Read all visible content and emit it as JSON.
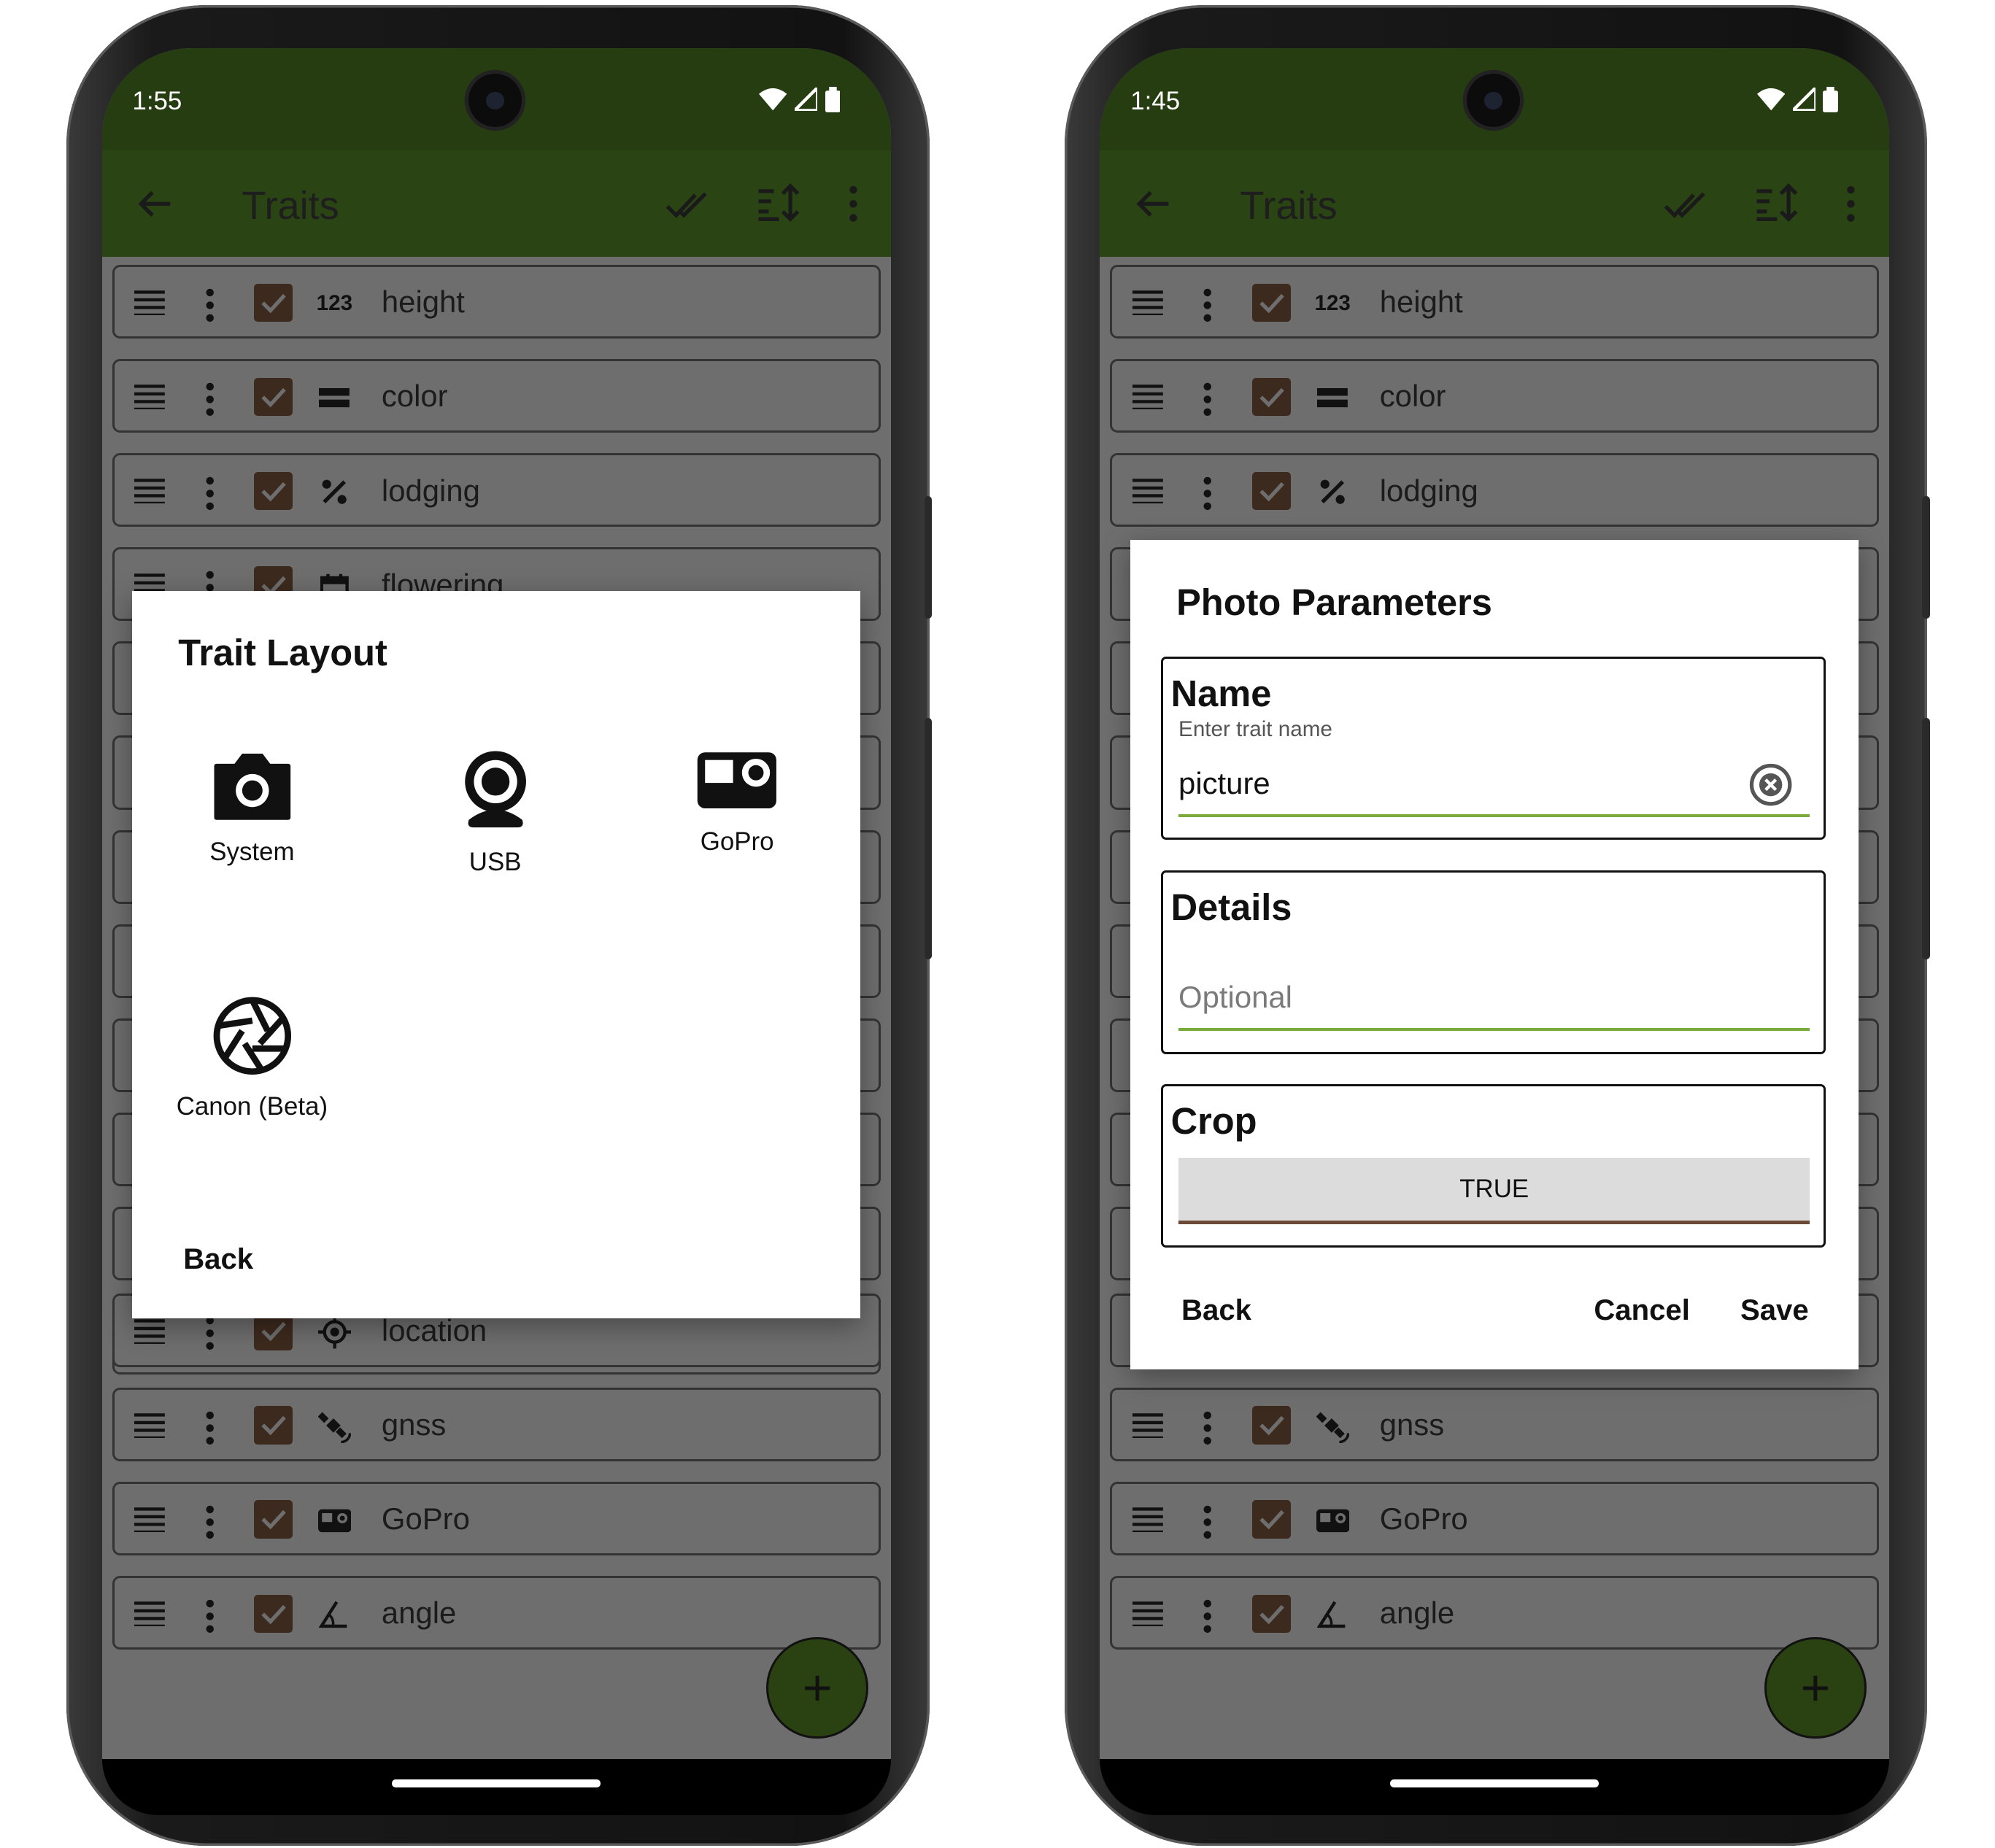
{
  "left_phone": {
    "status_time": "1:55",
    "appbar_title": "Traits",
    "traits": [
      {
        "name": "height",
        "icon": "numeric-123-icon"
      },
      {
        "name": "color",
        "icon": "categorical-icon"
      },
      {
        "name": "lodging",
        "icon": "percent-icon"
      },
      {
        "name": "flowering",
        "icon": "calendar-icon"
      },
      {
        "name": "location",
        "icon": "location-target-icon"
      },
      {
        "name": "gnss",
        "icon": "satellite-icon"
      },
      {
        "name": "GoPro",
        "icon": "gopro-icon"
      },
      {
        "name": "angle",
        "icon": "angle-icon"
      }
    ],
    "dialog": {
      "title": "Trait Layout",
      "options": [
        {
          "label": "System",
          "icon": "camera-icon"
        },
        {
          "label": "USB",
          "icon": "webcam-icon"
        },
        {
          "label": "GoPro",
          "icon": "gopro-icon"
        },
        {
          "label": "Canon (Beta)",
          "icon": "aperture-icon"
        }
      ],
      "back": "Back"
    }
  },
  "right_phone": {
    "status_time": "1:45",
    "appbar_title": "Traits",
    "traits": [
      {
        "name": "height",
        "icon": "numeric-123-icon"
      },
      {
        "name": "color",
        "icon": "categorical-icon"
      },
      {
        "name": "lodging",
        "icon": "percent-icon"
      },
      {
        "name": "gnss",
        "icon": "satellite-icon"
      },
      {
        "name": "GoPro",
        "icon": "gopro-icon"
      },
      {
        "name": "angle",
        "icon": "angle-icon"
      }
    ],
    "dialog": {
      "title": "Photo Parameters",
      "name_label": "Name",
      "name_hint": "Enter trait name",
      "name_value": "picture",
      "details_label": "Details",
      "details_placeholder": "Optional",
      "crop_label": "Crop",
      "crop_value": "TRUE",
      "back": "Back",
      "cancel": "Cancel",
      "save": "Save"
    }
  },
  "colors": {
    "status_bar": "#263d11",
    "appbar_dimmed": "#2b4412",
    "scrim_bg": "#6e6e6e",
    "checkbox": "#3d2a1e",
    "field_underline": "#7aab3c",
    "fab": "#2a4212"
  },
  "fab_label": "+"
}
